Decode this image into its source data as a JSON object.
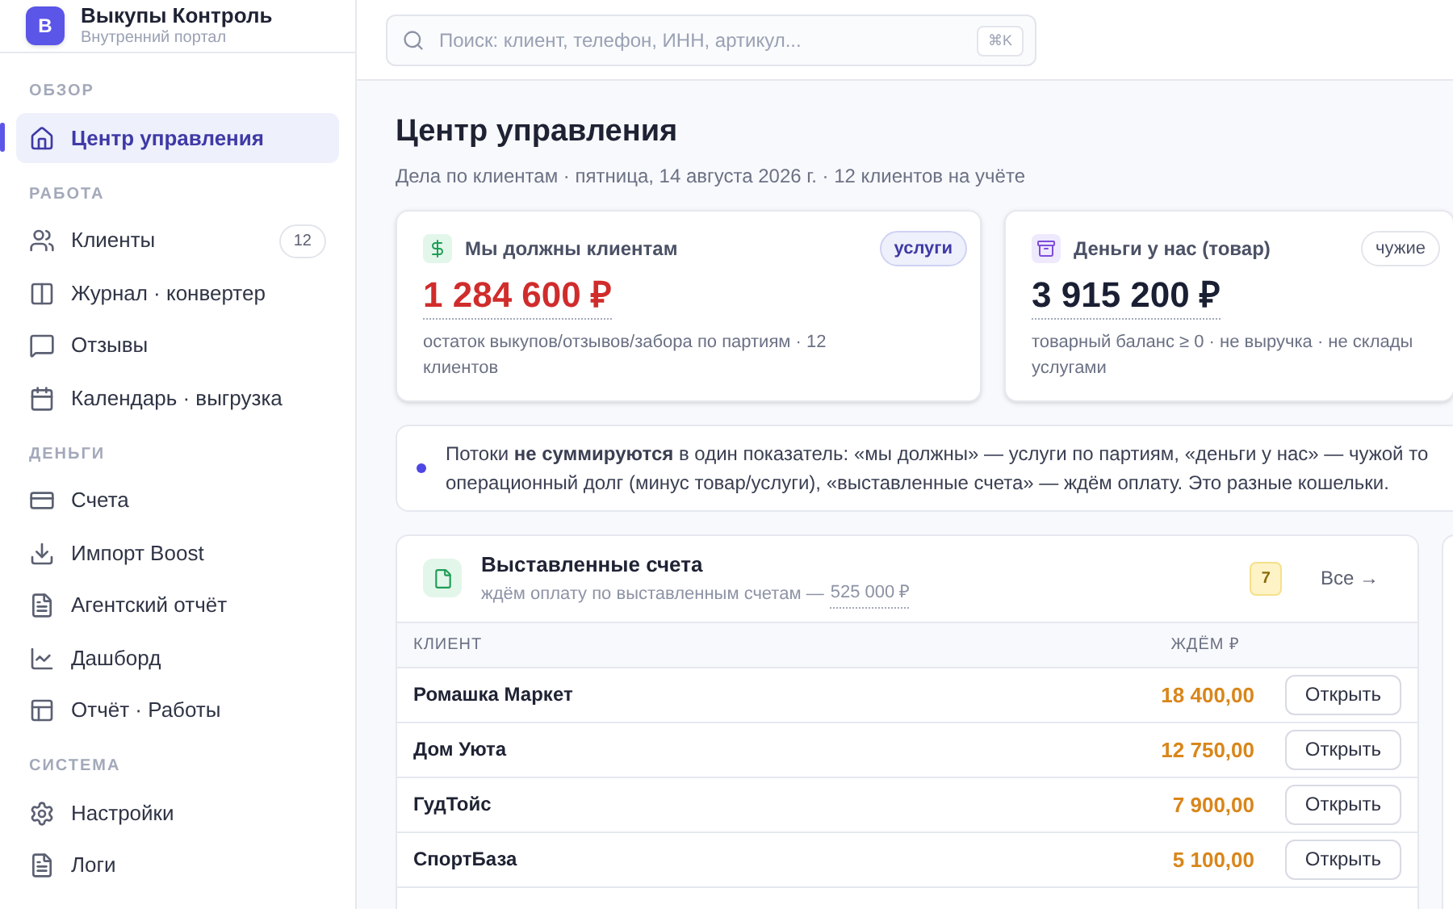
{
  "brand": {
    "logo_letter": "В",
    "title": "Выкупы Контроль",
    "subtitle": "Внутренний портал"
  },
  "sidebar": {
    "sections": [
      {
        "title": "ОБЗОР",
        "items": [
          {
            "label": "Центр управления",
            "selected": true
          }
        ]
      },
      {
        "title": "РАБОТА",
        "items": [
          {
            "label": "Клиенты",
            "badge": "12",
            "selected": false
          },
          {
            "label": "Журнал · конвертер",
            "selected": false
          },
          {
            "label": "Отзывы",
            "selected": false
          },
          {
            "label": "Календарь · выгрузка",
            "selected": false
          }
        ]
      },
      {
        "title": "ДЕНЬГИ",
        "items": [
          {
            "label": "Счета",
            "selected": false
          },
          {
            "label": "Импорт Boost",
            "selected": false
          },
          {
            "label": "Агентский отчёт",
            "selected": false
          },
          {
            "label": "Дашборд",
            "selected": false
          },
          {
            "label": "Отчёт · Работы",
            "selected": false
          }
        ]
      },
      {
        "title": "СИСТЕМА",
        "items": [
          {
            "label": "Настройки",
            "selected": false
          },
          {
            "label": "Логи",
            "selected": false
          }
        ]
      }
    ]
  },
  "search": {
    "placeholder": "Поиск: клиент, телефон, ИНН, артикул...",
    "shortcut": "⌘K"
  },
  "page": {
    "title": "Центр управления",
    "subtitle": "Дела по клиентам · пятница, 14 августа 2026 г. · 12 клиентов на учёте"
  },
  "cards": [
    {
      "title": "Мы должны клиентам",
      "tag": "услуги",
      "value": "1 284 600 ₽",
      "description": "остаток выкупов/отзывов/забора по партиям · 12\nклиентов"
    },
    {
      "title": "Деньги у нас (товар)",
      "tag": "чужие",
      "value": "3 915 200 ₽",
      "description": "товарный баланс ≥ 0 · не выручка · не склады\nуслугами"
    }
  ],
  "note": "Потоки **не суммируются** в один показатель: «мы должны» — услуги по партиям, «деньги у нас» — чужой то\nоперационный долг (минус товар/услуги), «выставленные счета» — ждём оплату. Это разные кошельки.",
  "invoices": {
    "title": "Выставленные счета",
    "subtitle": "ждём оплату по выставленным счетам —",
    "total": "525 000 ₽",
    "count": "7",
    "all_link": "Все →",
    "columns": [
      "КЛИЕНТ",
      "ЖДЁМ ₽"
    ],
    "rows": [
      {
        "client": "Ромашка Маркет",
        "amount": "18 400,00",
        "action": "Открыть"
      },
      {
        "client": "Дом Уюта",
        "amount": "12 750,00",
        "action": "Открыть"
      },
      {
        "client": "ГудТойс",
        "amount": "7 900,00",
        "action": "Открыть"
      },
      {
        "client": "СпортБаза",
        "amount": "5 100,00",
        "action": "Открыть"
      }
    ]
  }
}
